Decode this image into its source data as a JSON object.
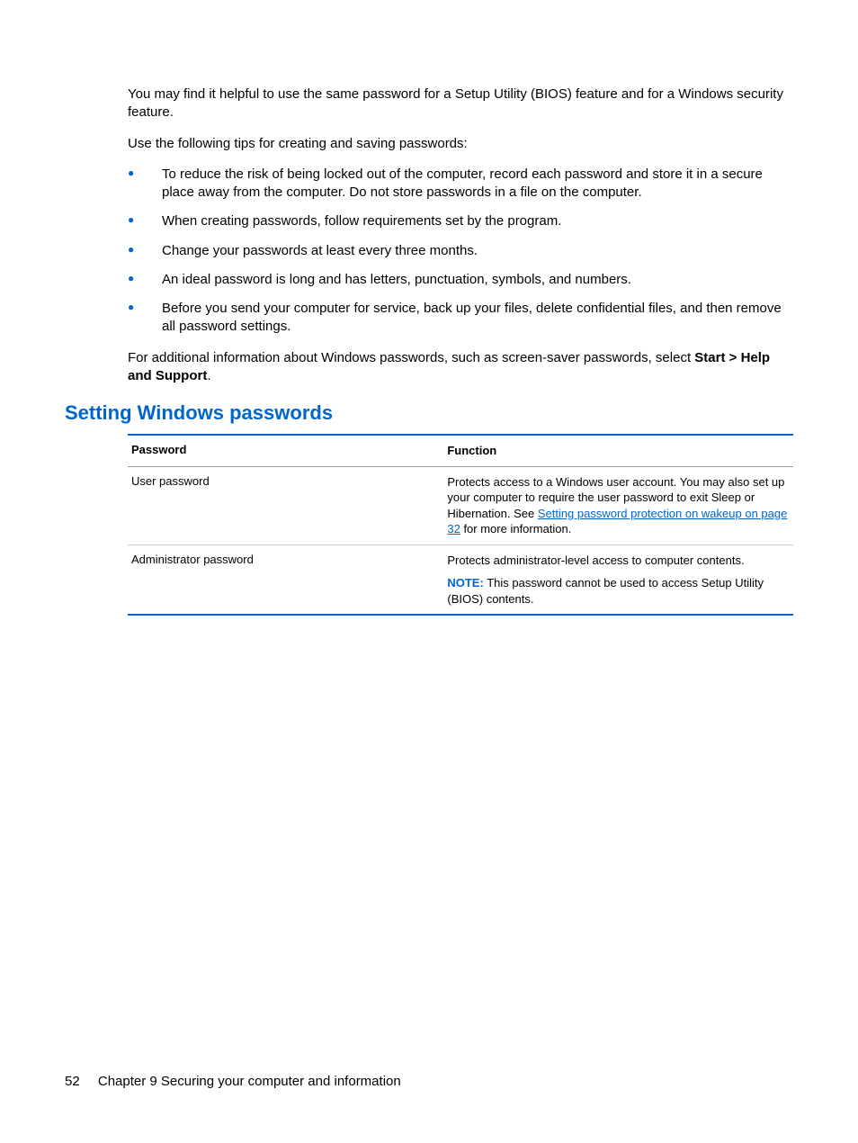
{
  "intro": {
    "para1": "You may find it helpful to use the same password for a Setup Utility (BIOS) feature and for a Windows security feature.",
    "para2": "Use the following tips for creating and saving passwords:"
  },
  "tips": {
    "item1": "To reduce the risk of being locked out of the computer, record each password and store it in a secure place away from the computer. Do not store passwords in a file on the computer.",
    "item2": "When creating passwords, follow requirements set by the program.",
    "item3": "Change your passwords at least every three months.",
    "item4": "An ideal password is long and has letters, punctuation, symbols, and numbers.",
    "item5": "Before you send your computer for service, back up your files, delete confidential files, and then remove all password settings."
  },
  "closing": {
    "text_before": "For additional information about Windows passwords, such as screen-saver passwords, select ",
    "bold": "Start > Help and Support",
    "text_after": "."
  },
  "section": {
    "heading": "Setting Windows passwords"
  },
  "table": {
    "header_password": "Password",
    "header_function": "Function",
    "row1": {
      "label": "User password",
      "desc_before": "Protects access to a Windows user account. You may also set up your computer to require the user password to exit Sleep or Hibernation. See ",
      "link": "Setting password protection on wakeup on page 32",
      "desc_after": " for more information."
    },
    "row2": {
      "label": "Administrator password",
      "desc": "Protects administrator-level access to computer contents.",
      "note_label": "NOTE:",
      "note_text": "This password cannot be used to access Setup Utility (BIOS) contents."
    }
  },
  "footer": {
    "page_number": "52",
    "chapter": "Chapter 9   Securing your computer and information"
  }
}
